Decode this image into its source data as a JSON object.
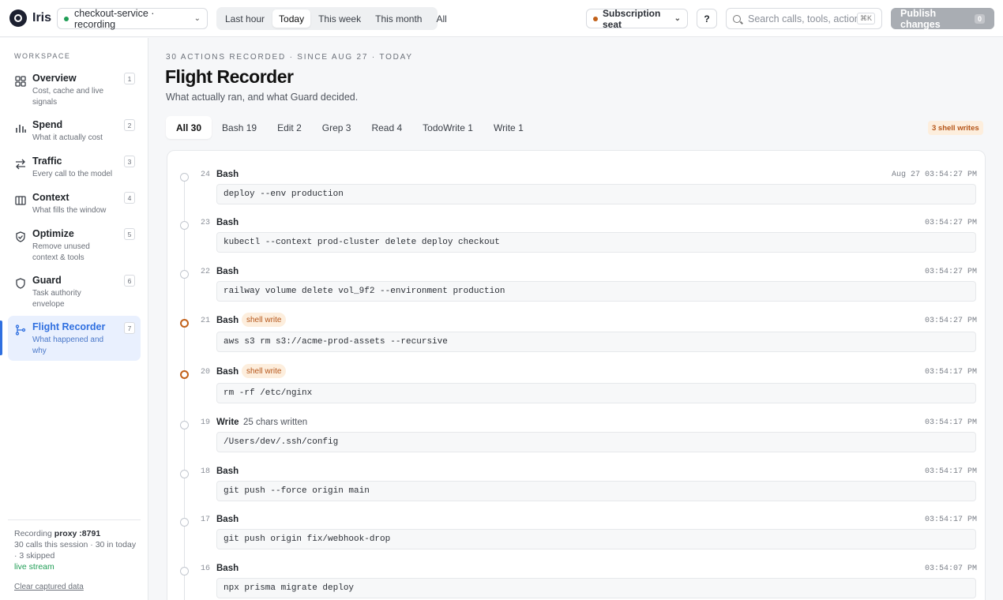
{
  "app": {
    "name": "Iris"
  },
  "header": {
    "project": "checkout-service · recording",
    "ranges": [
      "Last hour",
      "Today",
      "This week",
      "This month",
      "All"
    ],
    "active_range": "Today",
    "seat": "Subscription seat",
    "help": "?",
    "search_placeholder": "Search calls, tools, actions",
    "search_kbd": "⌘K",
    "publish": "Publish changes",
    "publish_count": "0"
  },
  "sidebar": {
    "section": "WORKSPACE",
    "items": [
      {
        "title": "Overview",
        "sub": "Cost, cache and live signals",
        "num": "1",
        "icon": "grid-icon"
      },
      {
        "title": "Spend",
        "sub": "What it actually cost",
        "num": "2",
        "icon": "bar-chart-icon"
      },
      {
        "title": "Traffic",
        "sub": "Every call to the model",
        "num": "3",
        "icon": "arrows-swap-icon"
      },
      {
        "title": "Context",
        "sub": "What fills the window",
        "num": "4",
        "icon": "columns-icon"
      },
      {
        "title": "Optimize",
        "sub": "Remove unused context & tools",
        "num": "5",
        "icon": "shield-check-icon"
      },
      {
        "title": "Guard",
        "sub": "Task authority envelope",
        "num": "6",
        "icon": "shield-icon"
      },
      {
        "title": "Flight Recorder",
        "sub": "What happened and why",
        "num": "7",
        "icon": "flow-icon",
        "active": true
      }
    ],
    "footer": {
      "recording_prefix": "Recording",
      "proxy": "proxy :8791",
      "summary": "30 calls this session · 30 in today · 3 skipped",
      "live": "live stream",
      "clear": "Clear captured data"
    }
  },
  "main": {
    "eyebrow": "30 ACTIONS RECORDED · SINCE AUG 27 · TODAY",
    "title": "Flight Recorder",
    "subtitle": "What actually ran, and what Guard decided.",
    "tabs": [
      "All 30",
      "Bash 19",
      "Edit 2",
      "Grep 3",
      "Read 4",
      "TodoWrite 1",
      "Write 1"
    ],
    "active_tab": "All 30",
    "shell_writes_badge": "3 shell writes",
    "entries": [
      {
        "num": "24",
        "tool": "Bash",
        "badge": "",
        "meta": "",
        "time": "Aug 27 03:54:27 PM",
        "cmd": "deploy --env production"
      },
      {
        "num": "23",
        "tool": "Bash",
        "badge": "",
        "meta": "",
        "time": "03:54:27 PM",
        "cmd": "kubectl --context prod-cluster delete deploy checkout"
      },
      {
        "num": "22",
        "tool": "Bash",
        "badge": "",
        "meta": "",
        "time": "03:54:27 PM",
        "cmd": "railway volume delete vol_9f2 --environment production"
      },
      {
        "num": "21",
        "tool": "Bash",
        "badge": "shell write",
        "meta": "",
        "time": "03:54:27 PM",
        "cmd": "aws s3 rm s3://acme-prod-assets --recursive"
      },
      {
        "num": "20",
        "tool": "Bash",
        "badge": "shell write",
        "meta": "",
        "time": "03:54:17 PM",
        "cmd": "rm -rf /etc/nginx"
      },
      {
        "num": "19",
        "tool": "Write",
        "badge": "",
        "meta": "25 chars written",
        "time": "03:54:17 PM",
        "cmd": "/Users/dev/.ssh/config"
      },
      {
        "num": "18",
        "tool": "Bash",
        "badge": "",
        "meta": "",
        "time": "03:54:17 PM",
        "cmd": "git push --force origin main"
      },
      {
        "num": "17",
        "tool": "Bash",
        "badge": "",
        "meta": "",
        "time": "03:54:17 PM",
        "cmd": "git push origin fix/webhook-drop"
      },
      {
        "num": "16",
        "tool": "Bash",
        "badge": "",
        "meta": "",
        "time": "03:54:07 PM",
        "cmd": "npx prisma migrate deploy"
      }
    ]
  },
  "colors": {
    "accent": "#2f6fe0",
    "shell_write": "#c2611a",
    "live": "#1f9d55"
  }
}
